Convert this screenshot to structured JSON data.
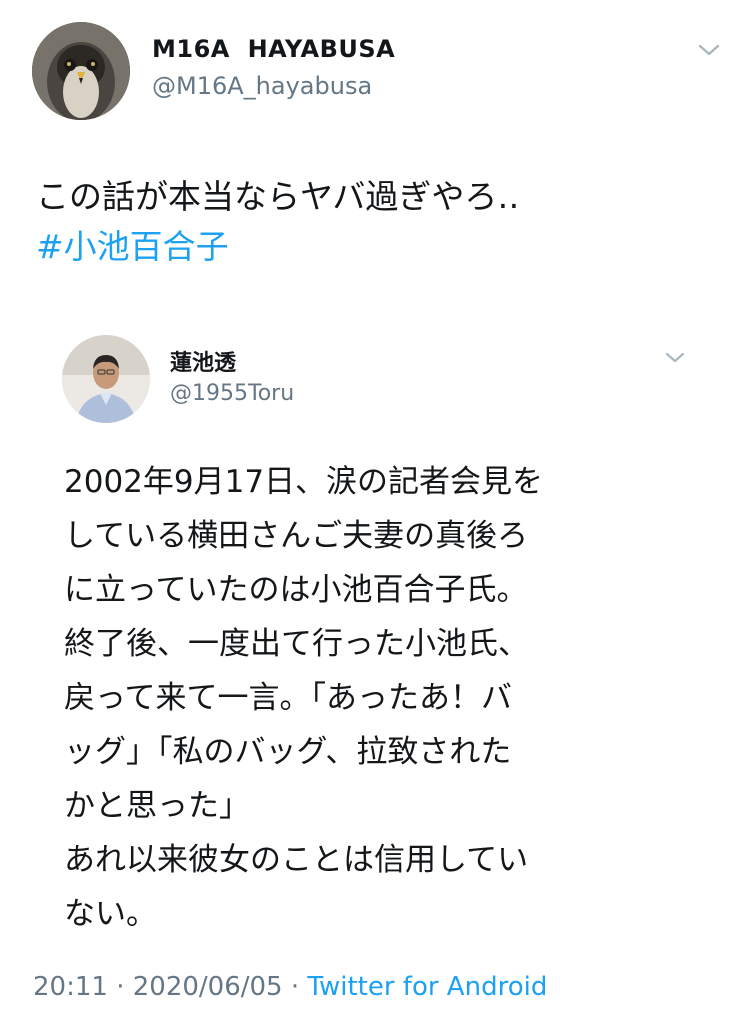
{
  "author": {
    "display_name": "M16A  HAYABUSA",
    "handle": "@M16A_hayabusa",
    "avatar_icon": "falcon-avatar"
  },
  "tweet": {
    "text": "この話が本当ならヤバ過ぎやろ‥",
    "hashtag": "#小池百合子"
  },
  "quoted": {
    "display_name": "蓮池透",
    "handle": "@1955Toru",
    "avatar_icon": "man-portrait-avatar",
    "lines": [
      "2002年9月17日、涙の記者会見を",
      "している横田さんご夫妻の真後ろ",
      "に立っていたのは小池百合子氏。",
      "終了後、一度出て行った小池氏、",
      "戻って来て一言。「あったあ！バ",
      "ッグ」「私のバッグ、拉致された",
      "かと思った」",
      "あれ以来彼女のことは信用してい",
      "ない。"
    ]
  },
  "meta": {
    "time": "20:11",
    "separator": "·",
    "date": "2020/06/05",
    "source": "Twitter for Android"
  },
  "colors": {
    "link": "#1da1f2",
    "secondary_text": "#657786",
    "primary_text": "#14171a"
  }
}
